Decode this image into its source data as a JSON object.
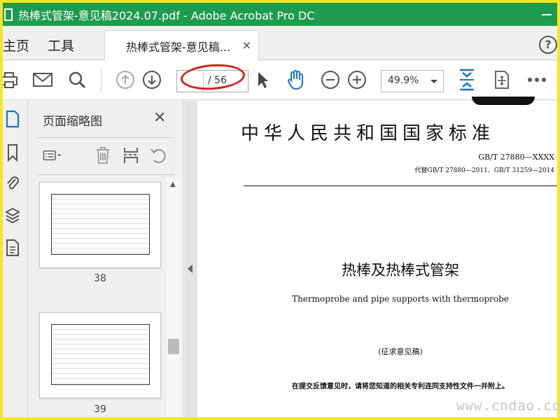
{
  "window": {
    "title": "热棒式管架-意见稿2024.07.pdf - Adobe Acrobat Pro DC"
  },
  "tabs": {
    "home": "主页",
    "tools": "工具",
    "document": "热棒式管架-意见稿...",
    "close": "×",
    "help": "?"
  },
  "toolbar": {
    "page_total": "/ 56",
    "zoom": "49.9%"
  },
  "thumbnails_panel": {
    "title": "页面缩略图",
    "close": "✕",
    "pages": [
      {
        "number": "38"
      },
      {
        "number": "39"
      }
    ]
  },
  "document": {
    "header": "中华人民共和国国家标准",
    "std_number": "GB/T 27880—XXXX",
    "replaces": "代替GB/T 27880—2011、GB/T 31259—2014",
    "title_cn": "热棒及热棒式管架",
    "title_en": "Thermoprobe and pipe supports with thermoprobe",
    "draft": "(征求意见稿)",
    "notice": "在提交反馈意见时，请将您知道的相关专利连同支持性文件一并附上。"
  },
  "watermark": "www.cndao.com",
  "colors": {
    "titlebar": "#1e9b4f",
    "accent": "#1a73c8",
    "highlight_oval": "#d8201a",
    "border": "#f5e62a"
  }
}
